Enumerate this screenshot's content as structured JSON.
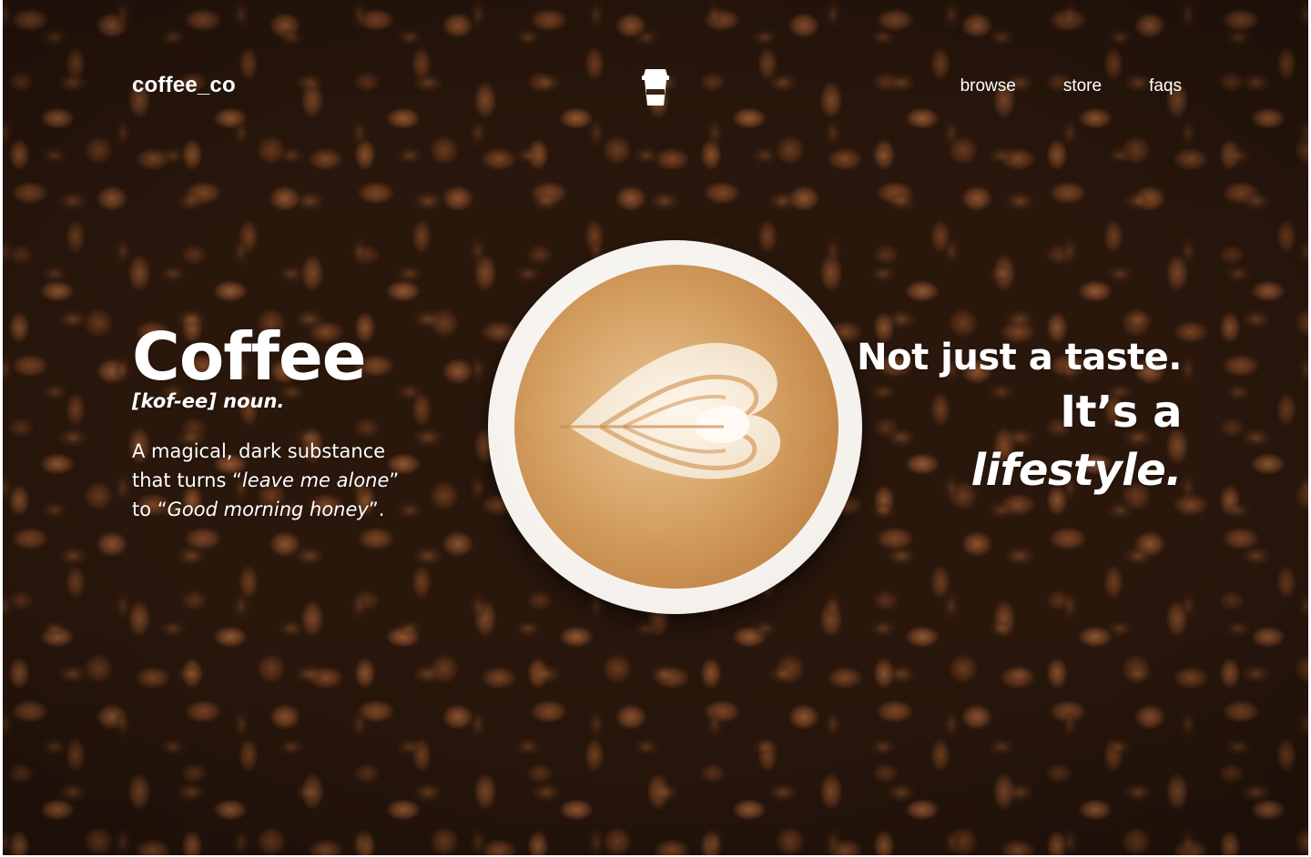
{
  "header": {
    "logo_text": "coffee_co",
    "center_icon": "coffee-cup-icon",
    "nav": [
      {
        "label": "browse"
      },
      {
        "label": "store"
      },
      {
        "label": "faqs"
      }
    ]
  },
  "hero": {
    "word": "Coffee",
    "pronunciation": "[kof-ee] noun.",
    "definition": {
      "line1": "A magical, dark substance",
      "line2_prefix": "that turns “",
      "line2_italic": "leave me alone",
      "line2_suffix": "”",
      "line3_prefix": "to “",
      "line3_italic": "Good morning honey",
      "line3_suffix": "”."
    },
    "tagline": {
      "line1": "Not just a taste.",
      "line2": "It’s a",
      "line3": "lifestyle."
    }
  },
  "colors": {
    "text": "#ffffff",
    "background": "#2a170c",
    "foam": "#d8a66a",
    "latte_art": "#fbf6ee"
  }
}
